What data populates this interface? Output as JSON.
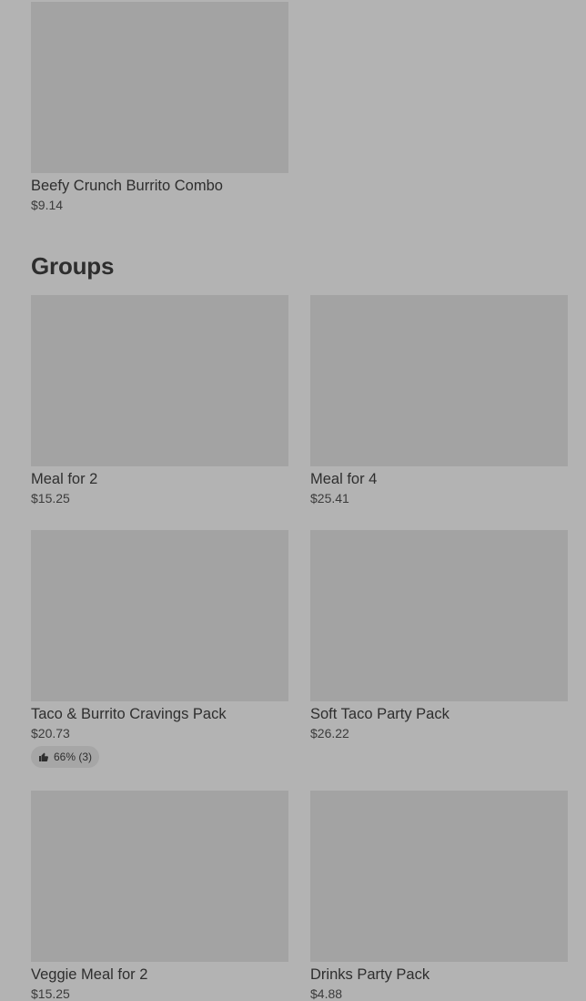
{
  "top_item": {
    "name": "Beefy Crunch Burrito Combo",
    "price": "$9.14"
  },
  "groups_section": {
    "title": "Groups",
    "items": [
      {
        "name": "Meal for 2",
        "price": "$15.25"
      },
      {
        "name": "Meal for 4",
        "price": "$25.41"
      },
      {
        "name": "Taco & Burrito Cravings Pack",
        "price": "$20.73",
        "rating": "66% (3)"
      },
      {
        "name": "Soft Taco Party Pack",
        "price": "$26.22"
      },
      {
        "name": "Veggie Meal for 2",
        "price": "$15.25"
      },
      {
        "name": "Drinks Party Pack",
        "price": "$4.88"
      }
    ]
  },
  "icons": {
    "rating_icon": "thumbs-up-icon"
  },
  "colors": {
    "page_background": "#b3b3b3",
    "image_placeholder": "#a3a3a3",
    "text": "#2e2e2e"
  }
}
